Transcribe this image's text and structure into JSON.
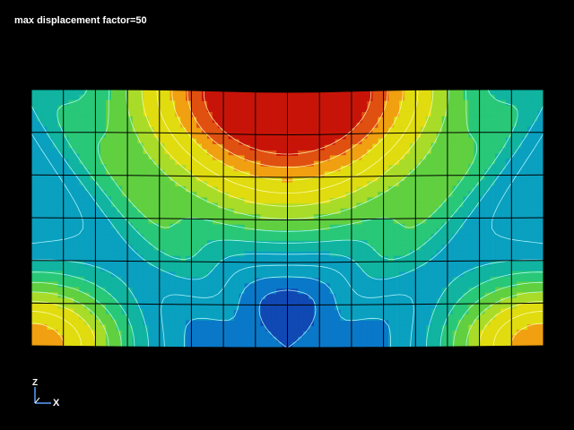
{
  "viewport": {
    "header": "max displacement factor=50"
  },
  "triad": {
    "vertical_axis": "Z",
    "horizontal_axis": "X"
  },
  "mesh": {
    "columns": 16,
    "rows": 6
  },
  "field": {
    "description_hotspots": [
      {
        "u": 0.5,
        "v": 0.0,
        "value": 1.0,
        "spread": 0.16
      },
      {
        "u": 0.0,
        "v": 1.0,
        "value": 0.72,
        "spread": 0.1
      },
      {
        "u": 1.0,
        "v": 1.0,
        "value": 0.72,
        "spread": 0.1
      }
    ],
    "contour_levels": 14
  },
  "colors": {
    "background": "#000000",
    "mesh_line": "#000000",
    "contour_line": "#bfffff",
    "triad_z": "#5aa0ff",
    "triad_x": "#5aa0ff",
    "text": "#ffffff",
    "colormap": [
      "#1a1aa0",
      "#1048b4",
      "#0a78c8",
      "#0aa0c0",
      "#10b4a0",
      "#28c878",
      "#60d040",
      "#a8dc28",
      "#e0dc10",
      "#f0a010",
      "#e05010",
      "#c81408"
    ]
  }
}
